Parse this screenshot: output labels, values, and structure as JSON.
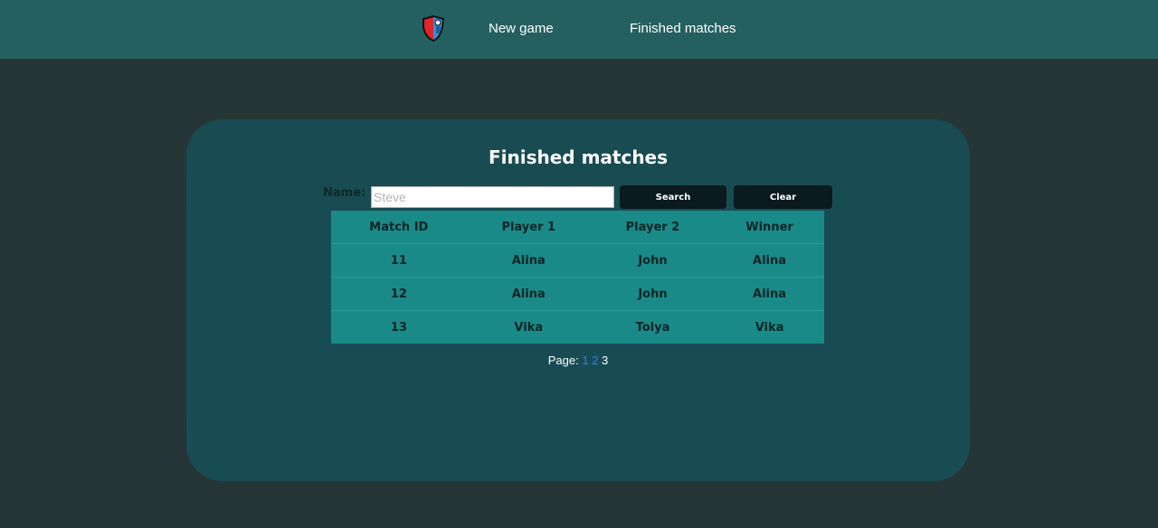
{
  "navbar": {
    "logo_icon": "shield-racket-logo",
    "links": [
      {
        "label": "New game"
      },
      {
        "label": "Finished matches"
      }
    ]
  },
  "main": {
    "title": "Finished matches",
    "search": {
      "label": "Name:",
      "placeholder": "Steve",
      "value": "",
      "search_label": "Search",
      "clear_label": "Clear"
    },
    "table": {
      "columns": [
        "Match ID",
        "Player 1",
        "Player 2",
        "Winner"
      ],
      "rows": [
        [
          "11",
          "Alina",
          "John",
          "Alina"
        ],
        [
          "12",
          "Alina",
          "John",
          "Alina"
        ],
        [
          "13",
          "Vika",
          "Tolya",
          "Vika"
        ]
      ]
    },
    "pagination": {
      "label": "Page:",
      "pages": [
        "1",
        "2",
        "3"
      ],
      "current": "3"
    }
  },
  "colors": {
    "navbar_bg": "#246060",
    "page_bg": "#263535",
    "panel_bg": "#184b52",
    "table_bg": "#1a8a88",
    "button_bg": "#0b1a1e",
    "link": "#2f7ff0"
  }
}
